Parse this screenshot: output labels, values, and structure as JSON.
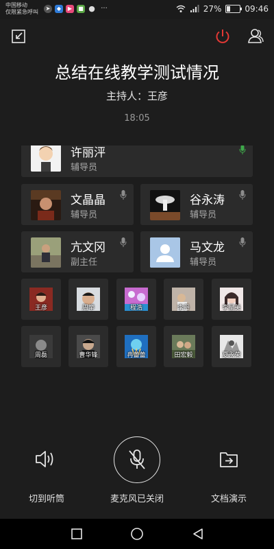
{
  "status_bar": {
    "carrier_line1": "中国移动",
    "carrier_line2": "仅限紧急呼叫",
    "battery": "27%",
    "battery_level": 0.27,
    "time": "09:46",
    "more": "···"
  },
  "header": {
    "title": "总结在线教学测试情况",
    "host": "主持人：王彦",
    "time": "18:05"
  },
  "participants_large": [
    {
      "name": "许丽泙",
      "role": "辅导员",
      "mic_color": "#3ea84a"
    },
    {
      "name": "文晶晶",
      "role": "辅导员",
      "mic_color": "#8c8c8c"
    },
    {
      "name": "谷永涛",
      "role": "辅导员",
      "mic_color": "#8c8c8c"
    },
    {
      "name": "亢文冈",
      "role": "副主任",
      "mic_color": "#8c8c8c"
    },
    {
      "name": "马文龙",
      "role": "辅导员",
      "mic_color": "#8c8c8c"
    }
  ],
  "participants_small": [
    {
      "name": "王彦"
    },
    {
      "name": "周举"
    },
    {
      "name": "程浩"
    },
    {
      "name": "李丹"
    },
    {
      "name": "李星美"
    },
    {
      "name": "周磊"
    },
    {
      "name": "曹华锋"
    },
    {
      "name": "冉蕾蕾"
    },
    {
      "name": "田宏毅"
    },
    {
      "name": "夏永荣"
    }
  ],
  "controls": {
    "speaker_label": "切到听筒",
    "mic_label": "麦克风已关闭",
    "share_label": "文档演示"
  },
  "colors": {
    "background": "#1d1d1d",
    "card": "#2b2b2b",
    "power_icon": "#e53935",
    "mic_active": "#3ea84a"
  }
}
